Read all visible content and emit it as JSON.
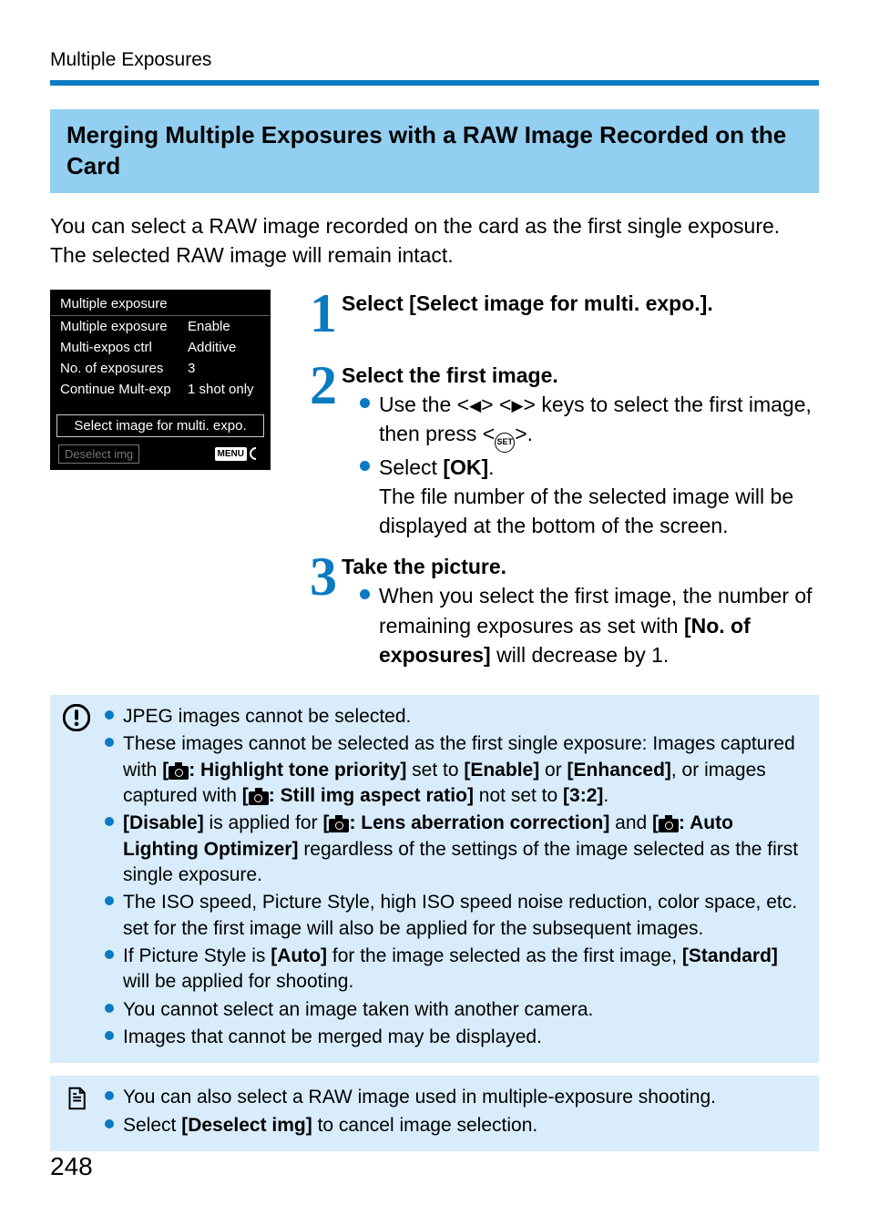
{
  "header_label": "Multiple Exposures",
  "section_title": "Merging Multiple Exposures with a RAW Image Recorded on the Card",
  "intro": "You can select a RAW image recorded on the card as the first single exposure. The selected RAW image will remain intact.",
  "menu": {
    "title": "Multiple exposure",
    "rows": [
      {
        "key": "Multiple exposure",
        "val": "Enable"
      },
      {
        "key": "Multi-expos ctrl",
        "val": "Additive"
      },
      {
        "key": "No. of exposures",
        "val": "3"
      },
      {
        "key": "Continue Mult-exp",
        "val": "1 shot only"
      }
    ],
    "option": "Select image for multi. expo.",
    "deselect": "Deselect img",
    "menu_label": "MENU"
  },
  "steps": {
    "s1": {
      "num": "1",
      "head": "Select [Select image for multi. expo.]."
    },
    "s2": {
      "num": "2",
      "head": "Select the first image.",
      "b1a": "Use the <",
      "b1b": "> <",
      "b1c": "> keys to select the first image, then press <",
      "b1d": ">.",
      "b2a": "Select ",
      "b2b": "[OK]",
      "b2c": ".",
      "b2_tail": "The file number of the selected image will be displayed at the bottom of the screen."
    },
    "s3": {
      "num": "3",
      "head": "Take the picture.",
      "b1a": "When you select the first image, the number of remaining exposures as set with ",
      "b1b": "[No. of exposures]",
      "b1c": " will decrease by 1."
    }
  },
  "notes1": {
    "n1": "JPEG images cannot be selected.",
    "n2a": "These images cannot be selected as the first single exposure: Images captured with ",
    "n2b": "[",
    "n2c": ": Highlight tone priority]",
    "n2d": " set to ",
    "n2e": "[Enable]",
    "n2f": " or ",
    "n2g": "[Enhanced]",
    "n2h": ", or images captured with ",
    "n2i": "[",
    "n2j": ": Still img aspect ratio]",
    "n2k": " not set to ",
    "n2l": "[3:2]",
    "n2m": ".",
    "n3a": "[Disable]",
    "n3b": " is applied for ",
    "n3c": "[",
    "n3d": ": Lens aberration correction]",
    "n3e": " and ",
    "n3f": "[",
    "n3g": ": Auto Lighting Optimizer]",
    "n3h": " regardless of the settings of the image selected as the first single exposure.",
    "n4": "The ISO speed, Picture Style, high ISO speed noise reduction, color space, etc. set for the first image will also be applied for the subsequent images.",
    "n5a": "If Picture Style is ",
    "n5b": "[Auto]",
    "n5c": " for the image selected as the first image, ",
    "n5d": "[Standard]",
    "n5e": " will be applied for shooting.",
    "n6": "You cannot select an image taken with another camera.",
    "n7": "Images that cannot be merged may be displayed."
  },
  "notes2": {
    "n1": "You can also select a RAW image used in multiple-exposure shooting.",
    "n2a": "Select ",
    "n2b": "[Deselect img]",
    "n2c": " to cancel image selection."
  },
  "page_number": "248",
  "set_label": "SET"
}
